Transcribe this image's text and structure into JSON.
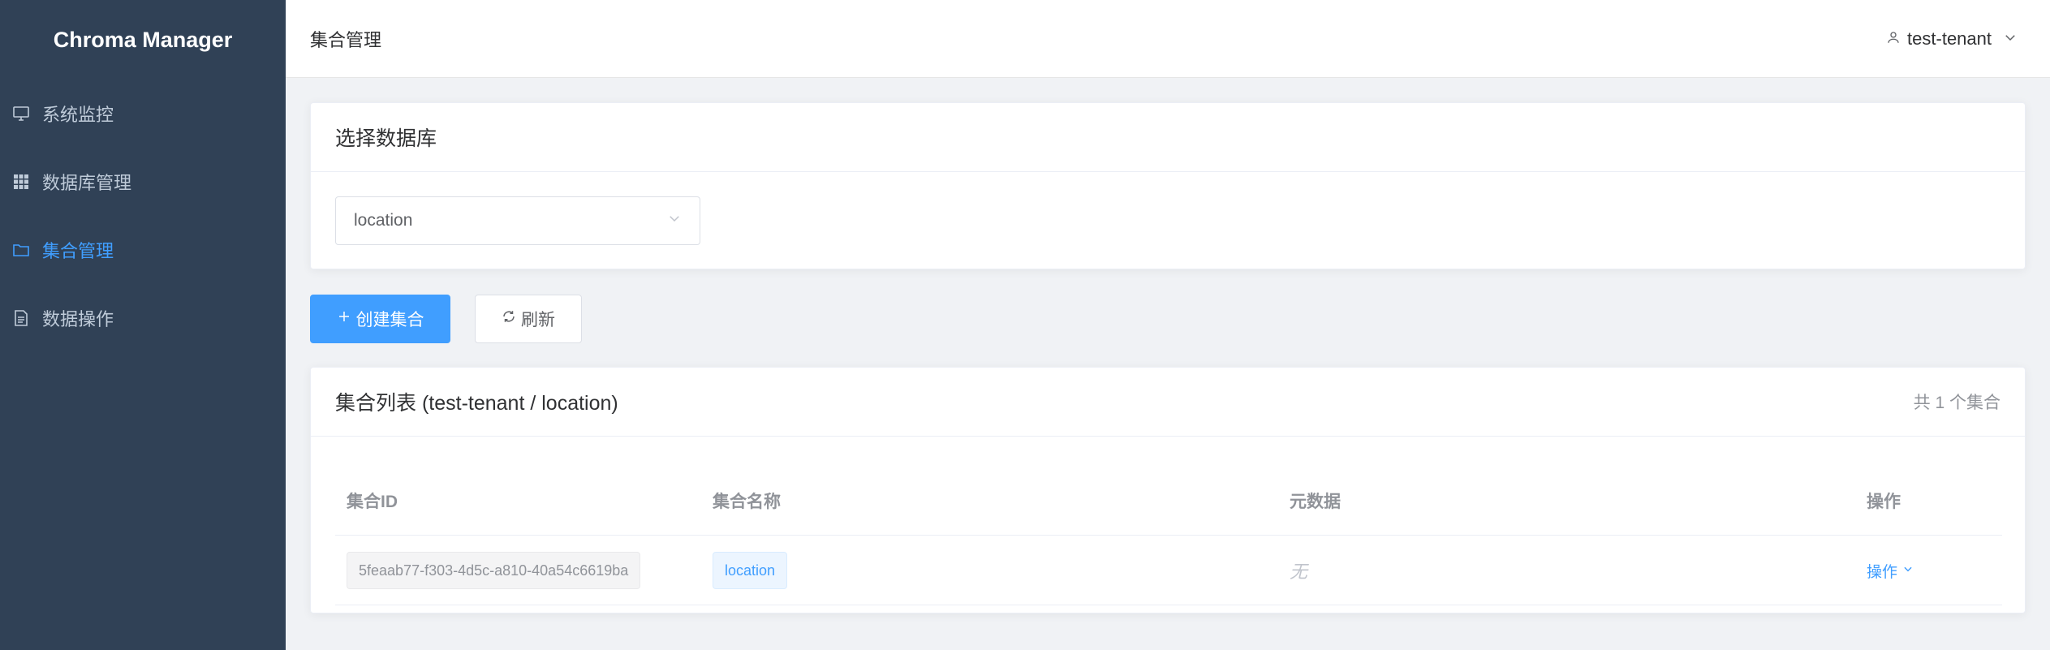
{
  "app": {
    "title": "Chroma Manager"
  },
  "sidebar": {
    "items": [
      {
        "label": "系统监控",
        "icon": "monitor-icon"
      },
      {
        "label": "数据库管理",
        "icon": "grid-icon"
      },
      {
        "label": "集合管理",
        "icon": "folder-icon",
        "active": true
      },
      {
        "label": "数据操作",
        "icon": "document-icon"
      }
    ]
  },
  "header": {
    "breadcrumb": "集合管理",
    "user": "test-tenant"
  },
  "database_card": {
    "title": "选择数据库",
    "select_value": "location"
  },
  "actions": {
    "create_label": "创建集合",
    "refresh_label": "刷新"
  },
  "collection_card": {
    "title": "集合列表 (test-tenant / location)",
    "count": "共 1 个集合",
    "columns": [
      "集合ID",
      "集合名称",
      "元数据",
      "操作"
    ],
    "rows": [
      {
        "id": "5feaab77-f303-4d5c-a810-40a54c6619ba",
        "name": "location",
        "metadata": "无",
        "action": "操作"
      }
    ]
  },
  "colors": {
    "sidebar_bg": "#304156",
    "accent": "#409eff",
    "page_bg": "#f0f2f5"
  }
}
